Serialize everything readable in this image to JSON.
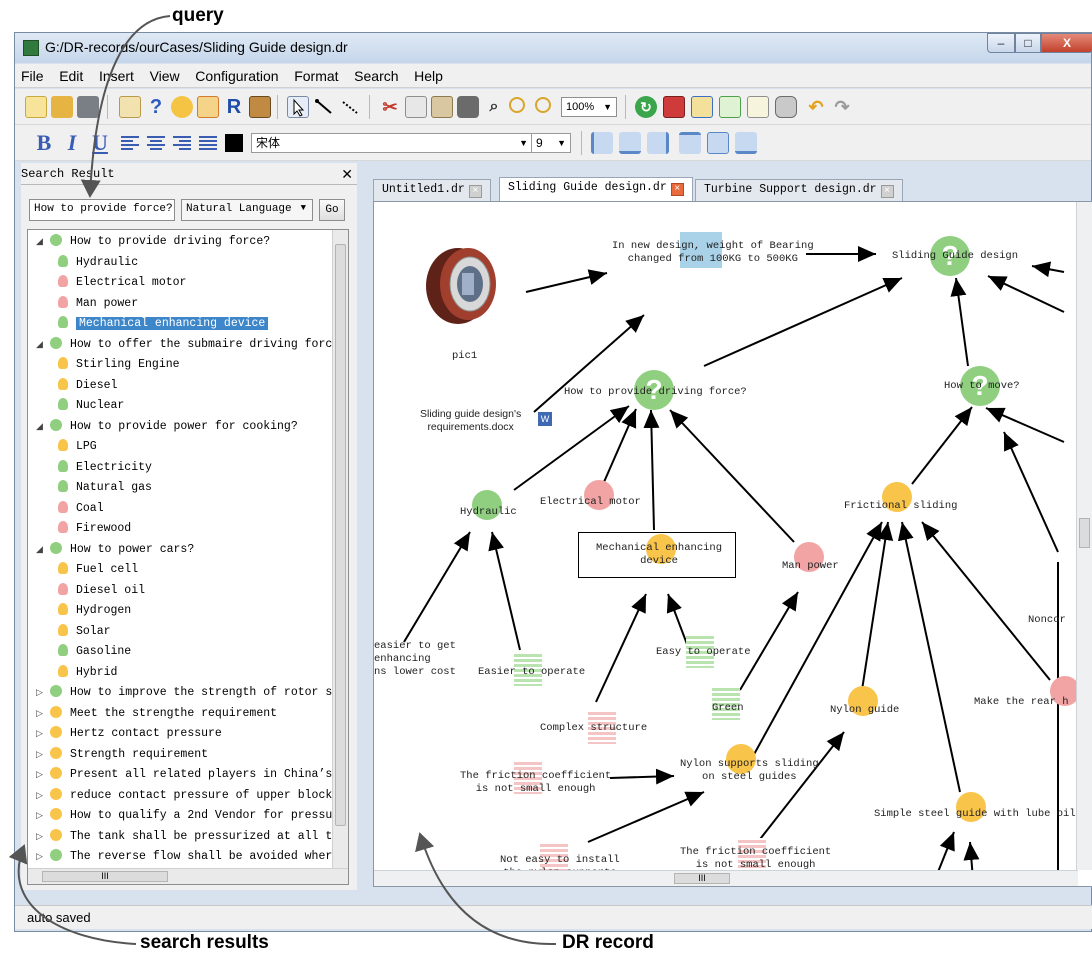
{
  "annotations": {
    "query": "query",
    "search_results": "search results",
    "dr_record": "DR record"
  },
  "window": {
    "title": "G:/DR-records/ourCases/Sliding Guide design.dr",
    "controls": {
      "minimize": "–",
      "maximize": "□",
      "close": "X"
    }
  },
  "menu": [
    "File",
    "Edit",
    "Insert",
    "View",
    "Configuration",
    "Format",
    "Search",
    "Help"
  ],
  "toolbar": {
    "zoom": "100%",
    "font_name": "宋体",
    "font_size": "9",
    "icons": [
      "new-file-icon",
      "open-folder-icon",
      "save-icon",
      "edit-icon",
      "help-icon",
      "idea-icon",
      "edit-note-icon",
      "r-icon",
      "image-icon",
      "pointer-icon",
      "line-icon",
      "dashed-line-icon",
      "cut-icon",
      "copy-icon",
      "paste-icon",
      "delete-icon",
      "find-icon",
      "zoom-in-icon",
      "zoom-out-icon",
      "refresh-icon",
      "book-icon",
      "notepad-icon",
      "document-icon",
      "list-icon",
      "database-icon",
      "undo-icon",
      "redo-icon"
    ]
  },
  "format_toolbar": {
    "bold": "B",
    "italic": "I",
    "underline": "U"
  },
  "search_panel": {
    "title": "Search Result",
    "close": "✕",
    "query": "How to provide force?",
    "mode": "Natural Language",
    "go": "Go",
    "tree": [
      {
        "level": 0,
        "expanded": true,
        "icon": "question",
        "text": "How to provide driving force?"
      },
      {
        "level": 1,
        "icon": "bulb-green",
        "text": "Hydraulic"
      },
      {
        "level": 1,
        "icon": "bulb-red",
        "text": "Electrical motor"
      },
      {
        "level": 1,
        "icon": "bulb-red",
        "text": "Man power"
      },
      {
        "level": 1,
        "icon": "bulb-green",
        "text": "Mechanical enhancing device",
        "selected": true
      },
      {
        "level": 0,
        "expanded": true,
        "icon": "question",
        "text": "How to offer the submaire driving forc"
      },
      {
        "level": 1,
        "icon": "bulb-yellow",
        "text": "Stirling Engine"
      },
      {
        "level": 1,
        "icon": "bulb-yellow",
        "text": "Diesel"
      },
      {
        "level": 1,
        "icon": "bulb-green",
        "text": "Nuclear"
      },
      {
        "level": 0,
        "expanded": true,
        "icon": "question",
        "text": "How to provide power for cooking?"
      },
      {
        "level": 1,
        "icon": "bulb-yellow",
        "text": "LPG"
      },
      {
        "level": 1,
        "icon": "bulb-green",
        "text": "Electricity"
      },
      {
        "level": 1,
        "icon": "bulb-green",
        "text": "Natural gas"
      },
      {
        "level": 1,
        "icon": "bulb-red",
        "text": "Coal"
      },
      {
        "level": 1,
        "icon": "bulb-red",
        "text": "Firewood"
      },
      {
        "level": 0,
        "expanded": true,
        "icon": "question",
        "text": "How to power cars?"
      },
      {
        "level": 1,
        "icon": "bulb-yellow",
        "text": "Fuel cell"
      },
      {
        "level": 1,
        "icon": "bulb-red",
        "text": "Diesel oil"
      },
      {
        "level": 1,
        "icon": "bulb-yellow",
        "text": "Hydrogen"
      },
      {
        "level": 1,
        "icon": "bulb-yellow",
        "text": "Solar"
      },
      {
        "level": 1,
        "icon": "bulb-green",
        "text": "Gasoline"
      },
      {
        "level": 1,
        "icon": "bulb-yellow",
        "text": "Hybrid"
      },
      {
        "level": 0,
        "expanded": false,
        "icon": "question",
        "text": "How to improve the strength of rotor s"
      },
      {
        "level": 0,
        "expanded": false,
        "icon": "question-yellow",
        "text": "Meet the strengthe requirement"
      },
      {
        "level": 0,
        "expanded": false,
        "icon": "question-yellow",
        "text": "Hertz contact pressure"
      },
      {
        "level": 0,
        "expanded": false,
        "icon": "question-yellow",
        "text": "Strength requirement"
      },
      {
        "level": 0,
        "expanded": false,
        "icon": "question-yellow",
        "text": "Present all related players in China’s"
      },
      {
        "level": 0,
        "expanded": false,
        "icon": "question-yellow",
        "text": "reduce contact pressure of upper block"
      },
      {
        "level": 0,
        "expanded": false,
        "icon": "question-yellow",
        "text": "How to qualify a 2nd Vendor for pressu"
      },
      {
        "level": 0,
        "expanded": false,
        "icon": "question-yellow",
        "text": "The tank shall be pressurized at all t"
      },
      {
        "level": 0,
        "expanded": false,
        "icon": "question",
        "text": "The reverse flow shall be avoided wher"
      }
    ],
    "hscroll_label": "III"
  },
  "tabs": [
    {
      "label": "Untitled1.dr",
      "active": false
    },
    {
      "label": "Sliding Guide design.dr",
      "active": true
    },
    {
      "label": "Turbine Support design.dr",
      "active": false
    }
  ],
  "canvas": {
    "hscroll_label": "III",
    "nodes": {
      "pic_label": "pic1",
      "bearing_note": "In new design, weight of Bearing\nchanged from 100KG to 500KG",
      "sliding_guide": "Sliding Guide design",
      "how_to_provide": "How to provide driving force?",
      "how_to_move": "How to move?",
      "requirements_doc": "Sliding guide design's\nrequirements.docx",
      "hydraulic": "Hydraulic",
      "electrical_motor": "Electrical motor",
      "mech_device": "Mechanical enhancing\ndevice",
      "man_power": "Man power",
      "frictional_sliding": "Frictional sliding",
      "noncon": "Noncor",
      "easier_left": "easier to get\nenhancing\nns lower cost",
      "easier_operate": "Easier to operate",
      "easy_operate": "Easy to operate",
      "complex_structure": "Complex structure",
      "green": "Green",
      "nylon_guide": "Nylon guide",
      "make_rear": "Make the rear h",
      "friction_left": "The friction coefficient\nis not small enough",
      "nylon_supports": "Nylon supports sliding\non steel guides",
      "simple_steel": "Simple steel guide with lube oil",
      "not_easy_install": "Not easy to install\nthe nylon supports",
      "friction_bottom": "The friction coefficient\nis not small enough"
    }
  },
  "status": "auto saved",
  "colors": {
    "green": "#8fcf7f",
    "red": "#f2a4a4",
    "yellow": "#f9c44a",
    "selected": "#3d86c9"
  }
}
